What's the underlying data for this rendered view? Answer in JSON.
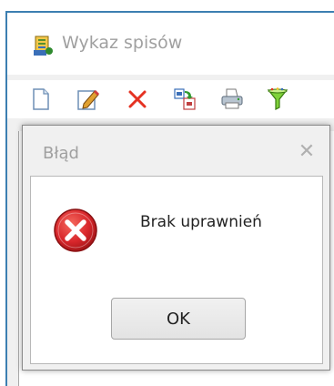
{
  "window": {
    "title": "Wykaz spisów"
  },
  "toolbar": {
    "buttons": [
      {
        "icon": "new-document-icon"
      },
      {
        "icon": "edit-icon"
      },
      {
        "icon": "delete-icon"
      },
      {
        "icon": "import-icon"
      },
      {
        "icon": "print-icon"
      },
      {
        "icon": "filter-icon"
      }
    ]
  },
  "dialog": {
    "title": "Błąd",
    "close_label": "✕",
    "message": "Brak uprawnień",
    "ok_label": "OK",
    "icon": "error-icon"
  },
  "colors": {
    "window_border": "#3c7fb1",
    "error_red": "#d8262b",
    "title_gray": "#a0a0a0"
  }
}
